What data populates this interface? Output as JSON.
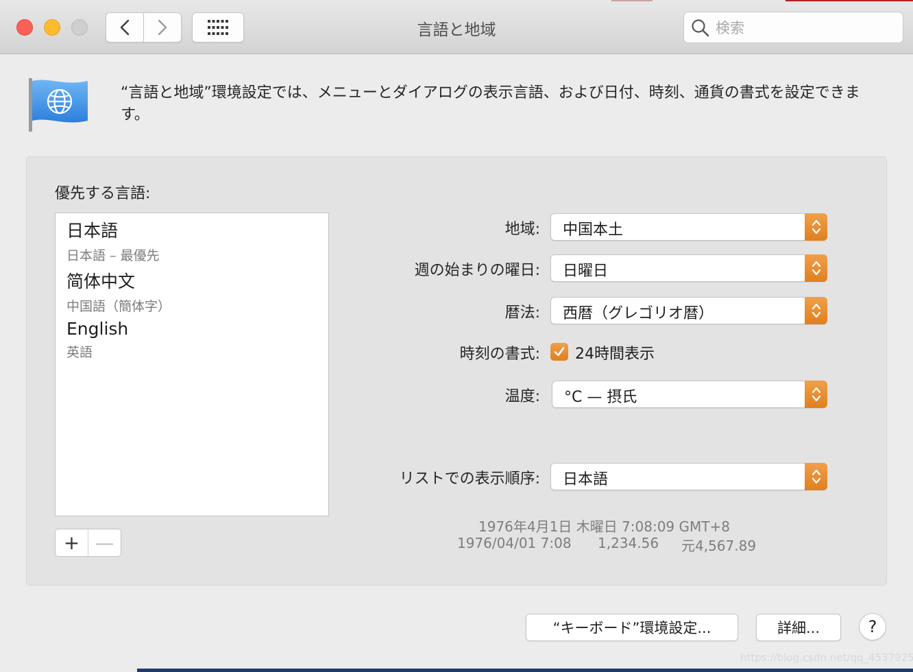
{
  "window": {
    "title": "言語と地域"
  },
  "search": {
    "placeholder": "検索"
  },
  "header": {
    "description": "“言語と地域”環境設定では、メニューとダイアログの表示言語、および日付、時刻、通貨の書式を設定できます。"
  },
  "preferred_languages": {
    "label": "優先する言語:",
    "items": [
      {
        "name": "日本語",
        "subtitle": "日本語 – 最優先"
      },
      {
        "name": "简体中文",
        "subtitle": "中国語（簡体字）"
      },
      {
        "name": "English",
        "subtitle": "英語"
      }
    ],
    "add_label": "+",
    "remove_label": "—"
  },
  "settings": {
    "region": {
      "label": "地域:",
      "value": "中国本土"
    },
    "first_day": {
      "label": "週の始まりの曜日:",
      "value": "日曜日"
    },
    "calendar": {
      "label": "暦法:",
      "value": "西暦（グレゴリオ暦）"
    },
    "time_format": {
      "label": "時刻の書式:",
      "checkbox_label": "24時間表示",
      "checked": true
    },
    "temperature": {
      "label": "温度:",
      "value": "°C — 摂氏"
    },
    "list_sort": {
      "label": "リストでの表示順序:",
      "value": "日本語"
    }
  },
  "sample": {
    "line1": "1976年4月1日 木曜日 7:08:09 GMT+8",
    "short_date": "1976/04/01 7:08",
    "number": "1,234.56",
    "currency": "元4,567.89"
  },
  "buttons": {
    "keyboard": "“キーボード”環境設定...",
    "advanced": "詳細...",
    "help": "?"
  },
  "watermark": "https://blog.csdn.net/qq_45379253",
  "colors": {
    "accent": "#e8892c",
    "close": "#fc5f57",
    "minimize": "#fdbc2e",
    "zoom_disabled": "#cfcfcf"
  },
  "icons": {
    "back": "chevron-left-icon",
    "forward": "chevron-right-icon",
    "grid": "grid-icon",
    "search": "search-icon",
    "flag": "globe-flag-icon"
  }
}
